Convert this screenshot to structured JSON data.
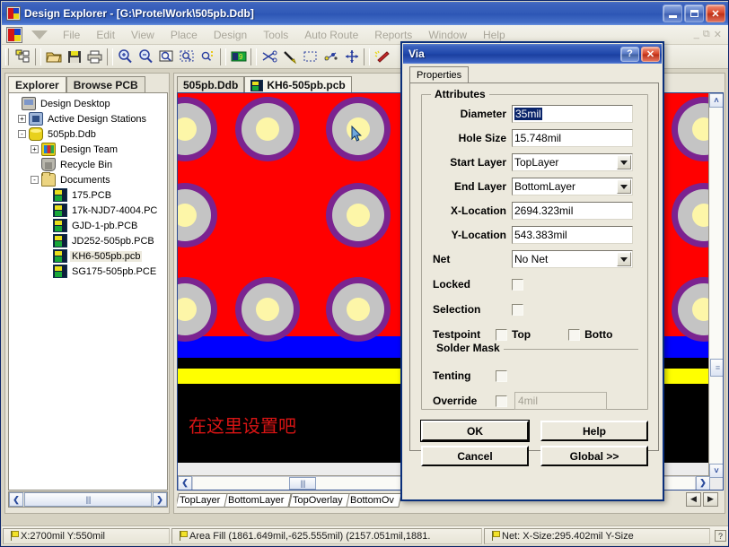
{
  "window": {
    "title": "Design Explorer - [G:\\ProtelWork\\505pb.Ddb]",
    "minimize_label": "_",
    "maximize_label": "□",
    "close_label": "X"
  },
  "menubar": {
    "items": [
      "File",
      "Edit",
      "View",
      "Place",
      "Design",
      "Tools",
      "Auto Route",
      "Reports",
      "Window",
      "Help"
    ],
    "mdi_buttons": [
      "_",
      "⧉",
      "✕"
    ]
  },
  "toolbar": {
    "buttons": [
      "explorer-panel-icon",
      "open-icon",
      "save-icon",
      "print-icon",
      "zoom-in-icon",
      "zoom-out-icon",
      "zoom-area-icon",
      "zoom-region-icon",
      "zoom-selected-icon",
      "browse-icon",
      "cut-icon",
      "paste-icon",
      "select-area-icon",
      "move-icon",
      "cross-probe-icon",
      "clear-filter-icon"
    ]
  },
  "left_panel": {
    "tabs": [
      {
        "label": "Explorer",
        "active": true
      },
      {
        "label": "Browse PCB",
        "active": false
      }
    ],
    "tree": [
      {
        "label": "Design Desktop",
        "indent": 0,
        "toggle": "",
        "icon": "desktop-icon",
        "selected": false
      },
      {
        "label": "Active Design Stations",
        "indent": 1,
        "toggle": "+",
        "icon": "station-icon",
        "selected": false
      },
      {
        "label": "505pb.Ddb",
        "indent": 1,
        "toggle": "-",
        "icon": "database-icon",
        "selected": false
      },
      {
        "label": "Design Team",
        "indent": 2,
        "toggle": "+",
        "icon": "team-icon",
        "selected": false
      },
      {
        "label": "Recycle Bin",
        "indent": 2,
        "toggle": "",
        "icon": "recycle-bin-icon",
        "selected": false
      },
      {
        "label": "Documents",
        "indent": 2,
        "toggle": "-",
        "icon": "folder-icon",
        "selected": false
      },
      {
        "label": "175.PCB",
        "indent": 3,
        "toggle": "",
        "icon": "pcb-document-icon",
        "selected": false
      },
      {
        "label": "17k-NJD7-4004.PC",
        "indent": 3,
        "toggle": "",
        "icon": "pcb-document-icon",
        "selected": false
      },
      {
        "label": "GJD-1-pb.PCB",
        "indent": 3,
        "toggle": "",
        "icon": "pcb-document-icon",
        "selected": false
      },
      {
        "label": "JD252-505pb.PCB",
        "indent": 3,
        "toggle": "",
        "icon": "pcb-document-icon",
        "selected": false
      },
      {
        "label": "KH6-505pb.pcb",
        "indent": 3,
        "toggle": "",
        "icon": "pcb-document-icon",
        "selected": true
      },
      {
        "label": "SG175-505pb.PCE",
        "indent": 3,
        "toggle": "",
        "icon": "pcb-document-icon",
        "selected": false
      }
    ],
    "hscroll": {
      "left_arrow": "❮",
      "right_arrow": "❯",
      "thumb": "||||"
    }
  },
  "document_area": {
    "tabs": [
      {
        "label": "505pb.Ddb",
        "active": false,
        "icon": null
      },
      {
        "label": "KH6-505pb.pcb",
        "active": true,
        "icon": "pcb-document-icon"
      }
    ],
    "canvas": {
      "board_color": "#ff0000",
      "pad_ring_color": "#7b2390",
      "pad_pad_color": "#c4c4c4",
      "pad_hole_color": "#fdf6a8",
      "annotation_text": "在这里设置吧",
      "annotation_color": "#d71414",
      "bands": [
        {
          "name": "blue-layer-band",
          "color": "#0000ff"
        },
        {
          "name": "black-gap-band",
          "color": "#000000"
        },
        {
          "name": "yellow-layer-band",
          "color": "#ffff00"
        },
        {
          "name": "black-background-band",
          "color": "#000000"
        }
      ]
    },
    "layer_tabs": [
      "TopLayer",
      "BottomLayer",
      "TopOverlay",
      "BottomOv"
    ],
    "nav_buttons": [
      "◀",
      "▶"
    ],
    "scroll": {
      "up": "˄",
      "down": "˅",
      "left": "❮",
      "right": "❯"
    }
  },
  "dialog": {
    "title": "Via",
    "help_button": "?",
    "close_button": "✕",
    "tabs": [
      {
        "label": "Properties",
        "active": true
      }
    ],
    "attributes_group": "Attributes",
    "fields": [
      {
        "name": "diameter",
        "label": "Diameter",
        "value": "35mil",
        "type": "text",
        "selected": true
      },
      {
        "name": "hole-size",
        "label": "Hole Size",
        "value": "15.748mil",
        "type": "text",
        "selected": false
      },
      {
        "name": "start-layer",
        "label": "Start Layer",
        "value": "TopLayer",
        "type": "combo",
        "selected": false
      },
      {
        "name": "end-layer",
        "label": "End Layer",
        "value": "BottomLayer",
        "type": "combo",
        "selected": false
      },
      {
        "name": "x-location",
        "label": "X-Location",
        "value": "2694.323mil",
        "type": "text",
        "selected": false
      },
      {
        "name": "y-location",
        "label": "Y-Location",
        "value": "543.383mil",
        "type": "text",
        "selected": false
      },
      {
        "name": "net",
        "label": "Net",
        "value": "No Net",
        "type": "combo",
        "selected": false
      },
      {
        "name": "locked",
        "label": "Locked",
        "value": "",
        "type": "checkbox",
        "checked": false
      },
      {
        "name": "selection",
        "label": "Selection",
        "value": "",
        "type": "checkbox",
        "checked": false
      }
    ],
    "testpoint": {
      "label": "Testpoint",
      "top_label": "Top",
      "top_checked": false,
      "bottom_label": "Botto",
      "bottom_checked": false
    },
    "solder_mask_group": "Solder Mask",
    "tenting": {
      "label": "Tenting",
      "checked": false
    },
    "override": {
      "label": "Override",
      "checked": false,
      "value": "4mil"
    },
    "buttons": {
      "ok": "OK",
      "help": "Help",
      "cancel": "Cancel",
      "global": "Global >>"
    }
  },
  "statusbar": {
    "panels": [
      {
        "name": "coordinates",
        "icon": "flag-icon",
        "text": "X:2700mil Y:550mil"
      },
      {
        "name": "object-info",
        "icon": "flag-icon",
        "text": "Area Fill (1861.649mil,-625.555mil) (2157.051mil,1881."
      },
      {
        "name": "net-info",
        "icon": "flag-icon",
        "text": "Net: X-Size:295.402mil Y-Size"
      }
    ],
    "help_button": "?"
  }
}
